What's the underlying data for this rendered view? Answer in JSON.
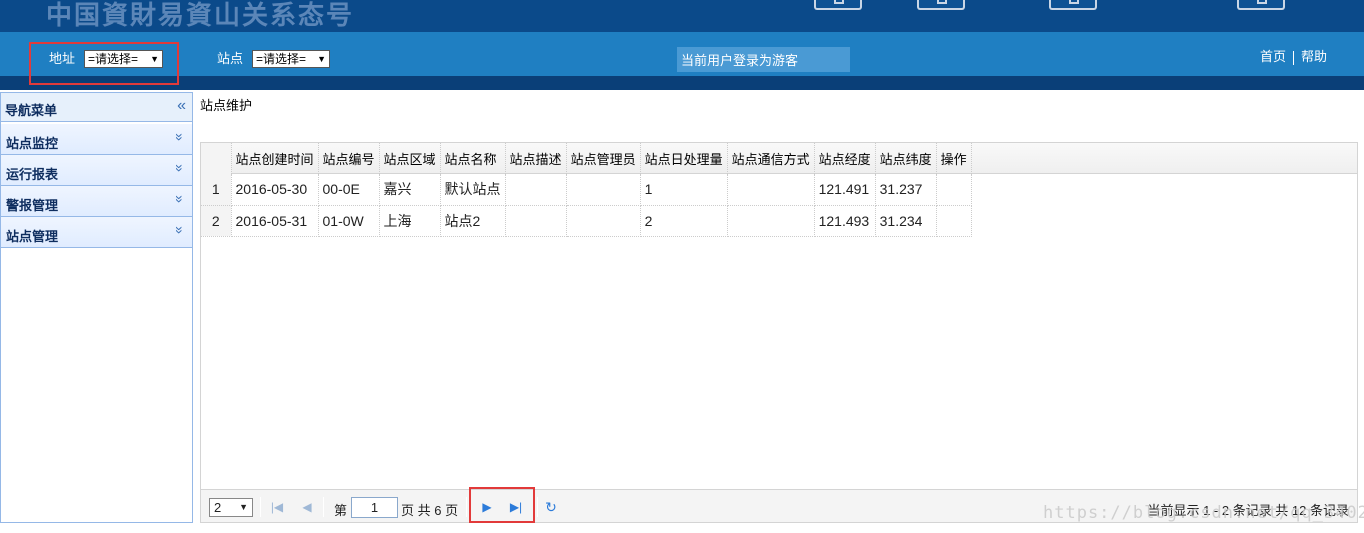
{
  "banner": {
    "title": "中国資財易資山关系态号"
  },
  "toolbar": {
    "address_label": "地址",
    "address_select": "=请选择=",
    "site_label": "站点",
    "site_select": "=请选择=",
    "login_status": "当前用户登录为游客",
    "home_link": "首页",
    "help_link": "帮助"
  },
  "sidebar": {
    "title": "导航菜单",
    "collapse_glyph": "«",
    "items": [
      {
        "label": "站点监控"
      },
      {
        "label": "运行报表"
      },
      {
        "label": "警报管理"
      },
      {
        "label": "站点管理"
      }
    ]
  },
  "main": {
    "heading": "站点维护",
    "columns": [
      "站点创建时间",
      "站点编号",
      "站点区域",
      "站点名称",
      "站点描述",
      "站点管理员",
      "站点日处理量",
      "站点通信方式",
      "站点经度",
      "站点纬度",
      "操作"
    ],
    "rows": [
      {
        "num": "1",
        "cells": [
          "2016-05-30",
          "00-0E",
          "嘉兴",
          "默认站点",
          "",
          "",
          "1",
          "",
          "121.491",
          "31.237",
          ""
        ]
      },
      {
        "num": "2",
        "cells": [
          "2016-05-31",
          "01-0W",
          "上海",
          "站点2",
          "",
          "",
          "2",
          "",
          "121.493",
          "31.234",
          ""
        ]
      }
    ]
  },
  "pager": {
    "page_size": "2",
    "prefix": "第",
    "current_page": "1",
    "suffix": "页 共 6 页",
    "info": "当前显示 1 - 2 条记录 共 12 条记录"
  },
  "watermark": "https://blog.csdn.net/qq_3402"
}
